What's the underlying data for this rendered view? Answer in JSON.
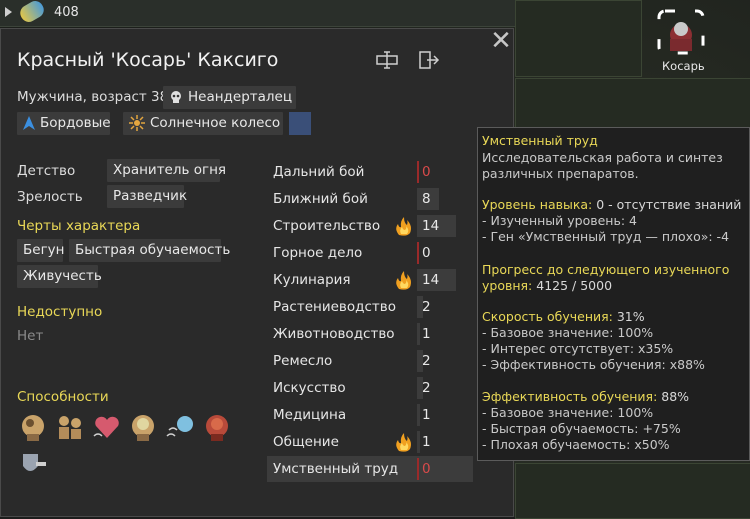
{
  "topbar": {
    "count": "408"
  },
  "colonist_tag": {
    "label": "Косарь"
  },
  "header": {
    "name": "Красный 'Косарь' Каксиго",
    "gender_age": "Мужчина, возраст 38",
    "xenotype": "Неандерталец",
    "ideo": "Бордовые",
    "faction": "Солнечное колесо"
  },
  "backstory": {
    "childhood_label": "Детство",
    "childhood_value": "Хранитель огня",
    "adulthood_label": "Зрелость",
    "adulthood_value": "Разведчик"
  },
  "traits": {
    "heading": "Черты характера",
    "items": [
      "Бегун",
      "Быстрая обучаемость",
      "Живучесть"
    ]
  },
  "incapable": {
    "heading": "Недоступно",
    "value": "Нет"
  },
  "abilities": {
    "heading": "Способности"
  },
  "skills": [
    {
      "name": "Дальний бой",
      "value": "0",
      "passion": 0,
      "level": 0
    },
    {
      "name": "Ближний бой",
      "value": "8",
      "passion": 0,
      "level": 8
    },
    {
      "name": "Строительство",
      "value": "14",
      "passion": 2,
      "level": 14
    },
    {
      "name": "Горное дело",
      "value": "0",
      "passion": 0,
      "level": 0
    },
    {
      "name": "Кулинария",
      "value": "14",
      "passion": 2,
      "level": 14
    },
    {
      "name": "Растениеводство",
      "value": "2",
      "passion": 0,
      "level": 2
    },
    {
      "name": "Животноводство",
      "value": "1",
      "passion": 0,
      "level": 1
    },
    {
      "name": "Ремесло",
      "value": "2",
      "passion": 0,
      "level": 2
    },
    {
      "name": "Искусство",
      "value": "2",
      "passion": 0,
      "level": 2
    },
    {
      "name": "Медицина",
      "value": "1",
      "passion": 0,
      "level": 1
    },
    {
      "name": "Общение",
      "value": "1",
      "passion": 2,
      "level": 1
    },
    {
      "name": "Умственный труд",
      "value": "0",
      "passion": 0,
      "level": 0
    }
  ],
  "tooltip": {
    "title": "Умственный труд",
    "desc1": "Исследовательская работа и синтез",
    "desc2": "различных препаратов.",
    "lvl_label": "Уровень навыка:",
    "lvl_value": " 0 - отсутствие знаний",
    "lvl_learned": "  - Изученный уровень: 4",
    "lvl_gene": "  - Ген «Умственный труд — плохо»: -4",
    "prog_label1": "Прогресс до следующего изученного",
    "prog_label2": "уровня:",
    "prog_value": " 4125 / 5000",
    "speed_label": "Скорость обучения:",
    "speed_value": " 31%",
    "speed_base": "  - Базовое значение: 100%",
    "speed_interest": "  - Интерес отсутствует: x35%",
    "speed_eff": "  - Эффективность обучения: x88%",
    "eff_label": "Эффективность обучения:",
    "eff_value": " 88%",
    "eff_base": "  - Базовое значение: 100%",
    "eff_fast": "  - Быстрая обучаемость: +75%",
    "eff_bad": "  - Плохая обучаемость: x50%"
  }
}
